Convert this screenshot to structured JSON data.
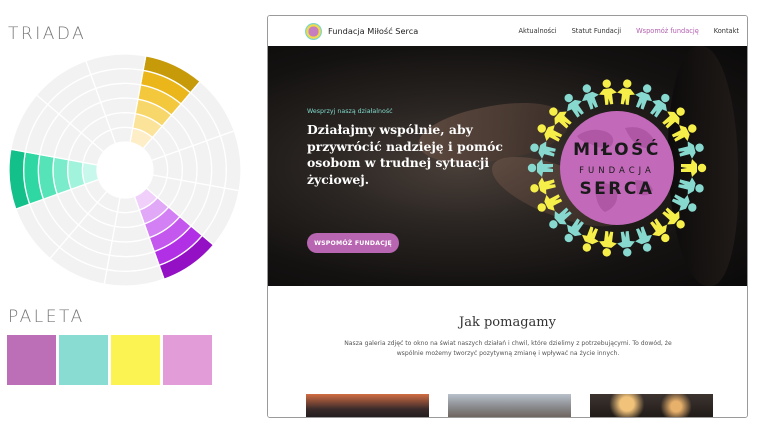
{
  "left_panel": {
    "triad_title": "TRIADA",
    "palette_title": "PALETA",
    "wheel": {
      "track_color": "#f2f2f2",
      "highlight_ring_count": 6,
      "segments": [
        {
          "name": "yellow",
          "colors": [
            "#c69a09",
            "#eab61a",
            "#f4c83c",
            "#f8d76a",
            "#fbe39a",
            "#fdeec7"
          ]
        },
        {
          "name": "teal",
          "colors": [
            "#14c08a",
            "#2fd7a2",
            "#55e3b7",
            "#7aeccb",
            "#a1f3dc",
            "#c8f8eb"
          ]
        },
        {
          "name": "purple",
          "colors": [
            "#9310c4",
            "#b12fe4",
            "#c458ee",
            "#d380f4",
            "#e2a8f8",
            "#f0d0fb"
          ]
        }
      ]
    },
    "palette": [
      "#bc6eb7",
      "#88dcd2",
      "#fbf352",
      "#e29dd9"
    ]
  },
  "browser": {
    "site_name": "Fundacja Miłość Serca",
    "nav_links": [
      {
        "label": "Aktualności",
        "active": false
      },
      {
        "label": "Statut Fundacji",
        "active": false
      },
      {
        "label": "Wspomóż fundację",
        "active": true
      },
      {
        "label": "Kontakt",
        "active": false
      }
    ],
    "hero": {
      "kicker": "Wesprzyj naszą działalność",
      "heading": "Działajmy wspólnie, aby przywrócić nadzieję i pomóc osobom w trudnej sytuacji życiowej.",
      "button_label": "WSPOMÓŻ FUNDACJĘ",
      "emblem_line1": "MIŁOŚĆ",
      "emblem_line2": "FUNDACJA",
      "emblem_line3": "SERCA",
      "emblem_figure_colors": [
        "#f6ef4a",
        "#87d9cf",
        "#87d9cf",
        "#f6ef4a"
      ]
    },
    "section": {
      "title": "Jak pomagamy",
      "text": "Nasza galeria zdjęć to okno na świat naszych działań i chwil, które dzielimy z potrzebującymi. To dowód, że wspólnie możemy tworzyć pozytywną zmianę i wpływać na życie innych."
    }
  }
}
